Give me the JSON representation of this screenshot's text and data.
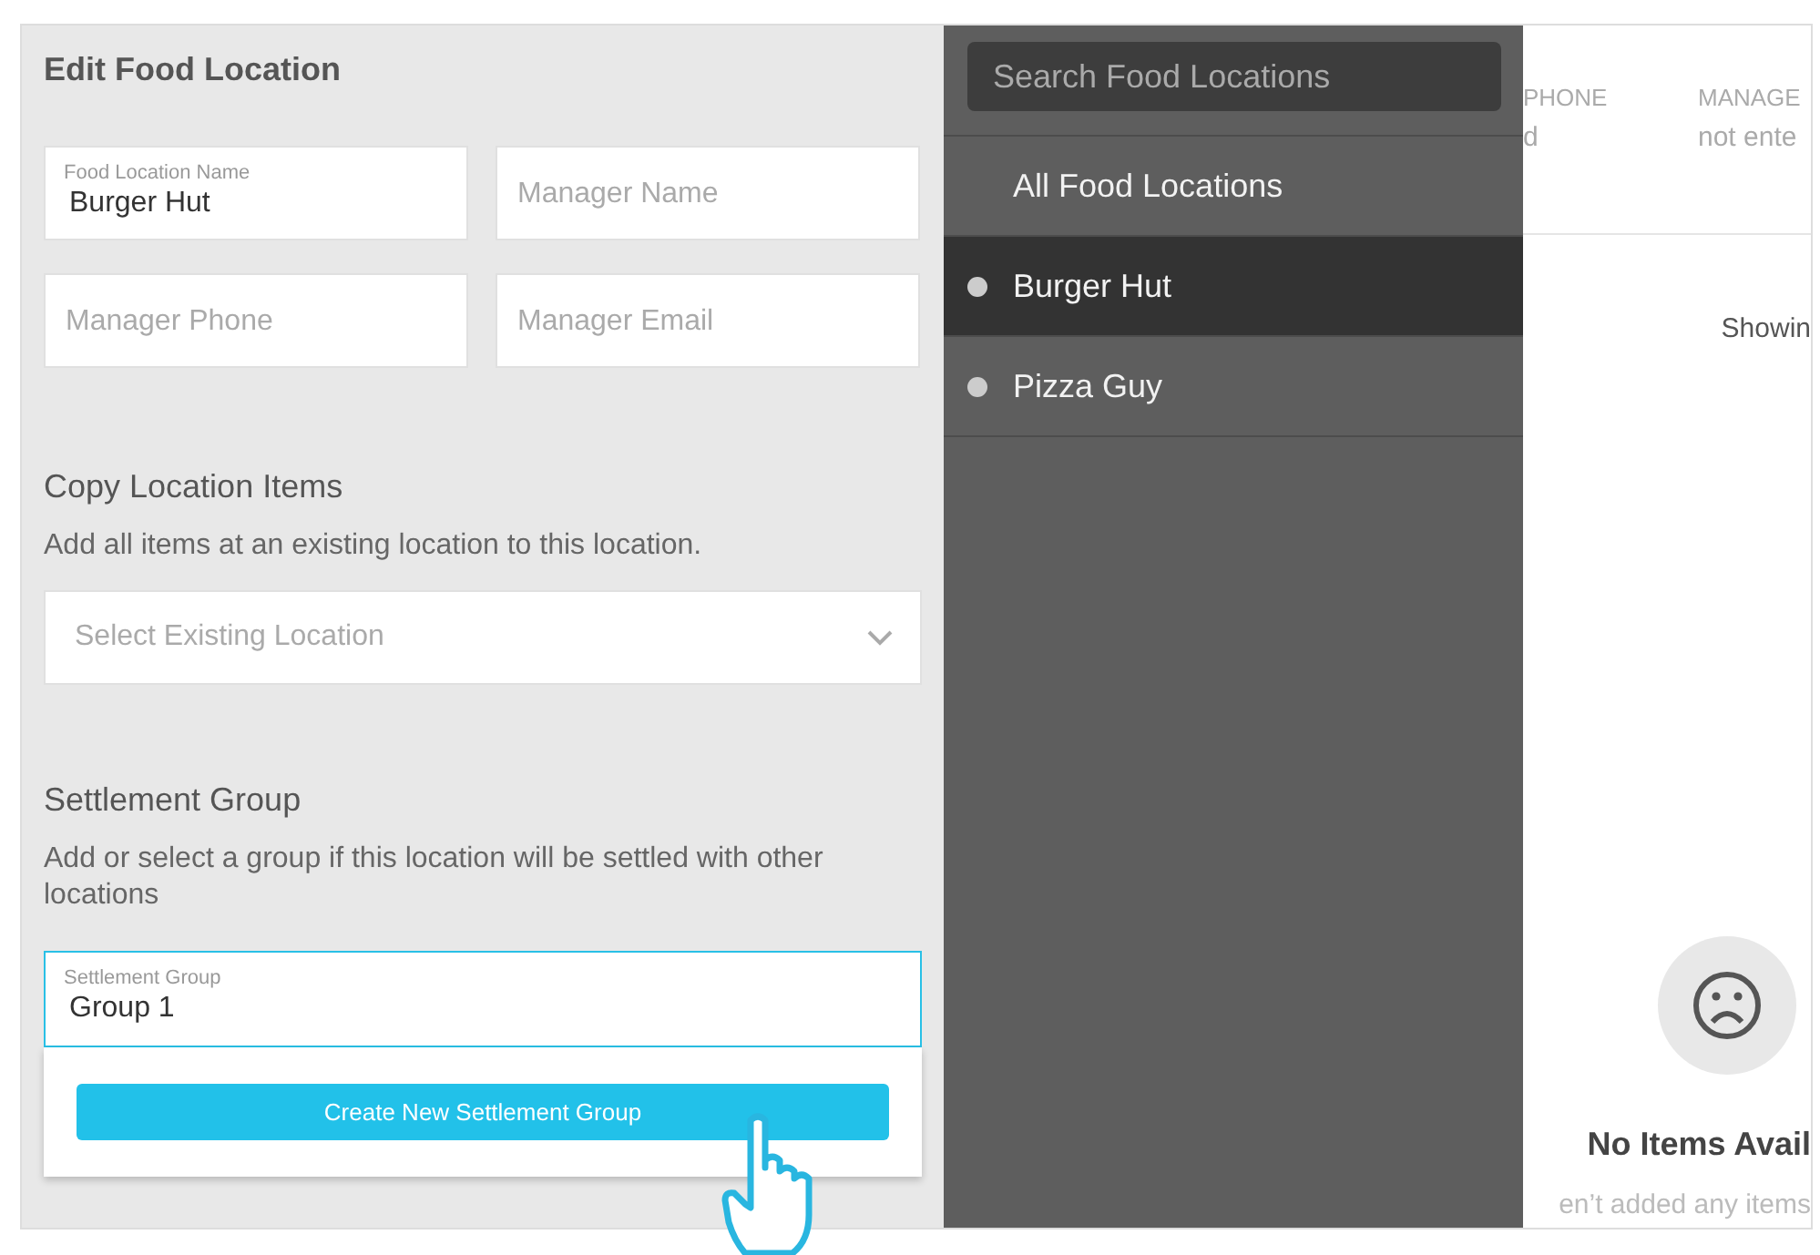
{
  "edit_panel": {
    "title": "Edit Food Location",
    "fields": [
      {
        "label": "Food Location Name",
        "value": "Burger Hut"
      },
      {
        "placeholder": "Manager Name"
      },
      {
        "placeholder": "Manager Phone"
      },
      {
        "placeholder": "Manager Email"
      }
    ],
    "copy_section": {
      "title": "Copy Location Items",
      "description": "Add all items at an existing location to this location.",
      "select": {
        "placeholder": "Select Existing Location"
      }
    },
    "settlement_section": {
      "title": "Settlement Group",
      "description": "Add or select a group if this location will be settled with other locations",
      "field": {
        "label": "Settlement Group",
        "value": "Group 1",
        "focused": true
      },
      "create_button": "Create New Settlement Group"
    }
  },
  "sidebar": {
    "search": {
      "placeholder": "Search Food Locations"
    },
    "items": [
      {
        "label": "All Food Locations",
        "kind": "all",
        "selected": false
      },
      {
        "label": "Burger Hut",
        "kind": "location",
        "selected": true
      },
      {
        "label": "Pizza Guy",
        "kind": "location",
        "selected": false
      }
    ]
  },
  "background_page": {
    "columns": [
      {
        "heading": "PHONE",
        "value": "d"
      },
      {
        "heading": "MANAGE",
        "value": "not ente"
      }
    ],
    "showing": "Showin",
    "empty_state": {
      "title": "No Items Avail",
      "message": "en’t added any items"
    }
  }
}
